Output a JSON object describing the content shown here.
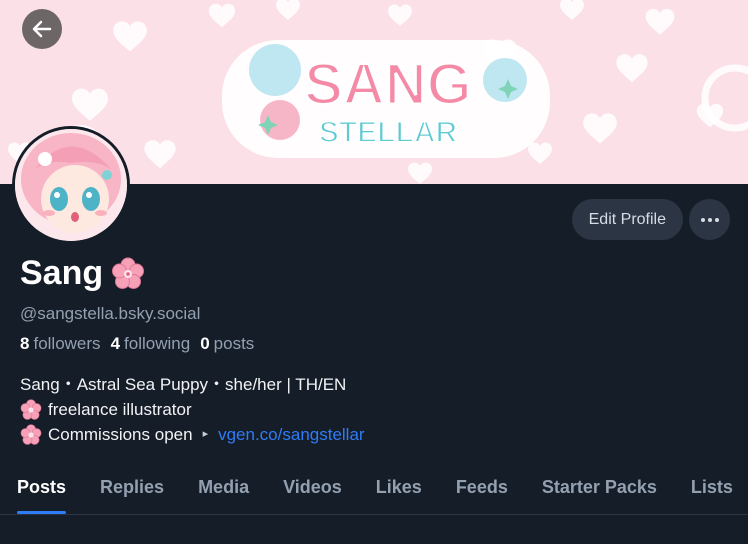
{
  "banner": {
    "logo_line1": "SANG",
    "logo_line2": "STELLAR"
  },
  "colors": {
    "background": "#151d28",
    "accent": "#2e7cf6",
    "banner_pink": "#fbe1e7",
    "muted_text": "#93a0b0",
    "button_bg": "#2b3543"
  },
  "header": {
    "back_icon": "arrow-left-icon"
  },
  "profile": {
    "display_name": "Sang",
    "name_emoji_icon": "cherry-blossom-icon",
    "handle": "@sangstella.bsky.social",
    "followers_count": "8",
    "followers_label": "followers",
    "following_count": "4",
    "following_label": "following",
    "posts_count": "0",
    "posts_label": "posts"
  },
  "actions": {
    "edit_profile_label": "Edit Profile",
    "more_icon": "ellipsis-icon"
  },
  "bio": {
    "line1": "Sang・Astral Sea Puppy・she/her | TH/EN",
    "line2": "freelance illustrator",
    "line3_text": "Commissions open",
    "line3_link": "vgen.co/sangstellar"
  },
  "tabs": [
    {
      "label": "Posts",
      "active": true
    },
    {
      "label": "Replies"
    },
    {
      "label": "Media"
    },
    {
      "label": "Videos"
    },
    {
      "label": "Likes"
    },
    {
      "label": "Feeds"
    },
    {
      "label": "Starter Packs"
    },
    {
      "label": "Lists"
    }
  ]
}
